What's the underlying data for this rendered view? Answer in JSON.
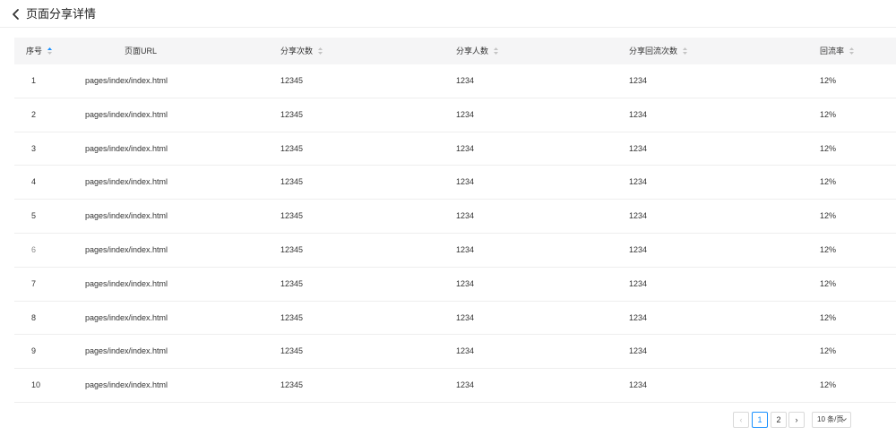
{
  "header": {
    "title": "页面分享详情",
    "back_icon": "chevron-left-icon"
  },
  "table": {
    "columns": [
      {
        "key": "index",
        "label": "序号",
        "sortable": true,
        "sort": "asc"
      },
      {
        "key": "url",
        "label": "页面URL",
        "sortable": false
      },
      {
        "key": "share_count",
        "label": "分享次数",
        "sortable": true
      },
      {
        "key": "share_users",
        "label": "分享人数",
        "sortable": true
      },
      {
        "key": "return_count",
        "label": "分享回流次数",
        "sortable": true
      },
      {
        "key": "return_rate",
        "label": "回流率",
        "sortable": true
      }
    ],
    "rows": [
      {
        "index": "1",
        "url": "pages/index/index.html",
        "share_count": "12345",
        "share_users": "1234",
        "return_count": "1234",
        "return_rate": "12%"
      },
      {
        "index": "2",
        "url": "pages/index/index.html",
        "share_count": "12345",
        "share_users": "1234",
        "return_count": "1234",
        "return_rate": "12%"
      },
      {
        "index": "3",
        "url": "pages/index/index.html",
        "share_count": "12345",
        "share_users": "1234",
        "return_count": "1234",
        "return_rate": "12%"
      },
      {
        "index": "4",
        "url": "pages/index/index.html",
        "share_count": "12345",
        "share_users": "1234",
        "return_count": "1234",
        "return_rate": "12%"
      },
      {
        "index": "5",
        "url": "pages/index/index.html",
        "share_count": "12345",
        "share_users": "1234",
        "return_count": "1234",
        "return_rate": "12%"
      },
      {
        "index": "6",
        "url": "pages/index/index.html",
        "share_count": "12345",
        "share_users": "1234",
        "return_count": "1234",
        "return_rate": "12%"
      },
      {
        "index": "7",
        "url": "pages/index/index.html",
        "share_count": "12345",
        "share_users": "1234",
        "return_count": "1234",
        "return_rate": "12%"
      },
      {
        "index": "8",
        "url": "pages/index/index.html",
        "share_count": "12345",
        "share_users": "1234",
        "return_count": "1234",
        "return_rate": "12%"
      },
      {
        "index": "9",
        "url": "pages/index/index.html",
        "share_count": "12345",
        "share_users": "1234",
        "return_count": "1234",
        "return_rate": "12%"
      },
      {
        "index": "10",
        "url": "pages/index/index.html",
        "share_count": "12345",
        "share_users": "1234",
        "return_count": "1234",
        "return_rate": "12%"
      }
    ]
  },
  "pagination": {
    "prev_label": "‹",
    "next_label": "›",
    "pages": [
      "1",
      "2"
    ],
    "current_page": "1",
    "page_size_label": "10 条/页"
  },
  "colors": {
    "accent": "#1890ff",
    "header_bg": "#f5f5f6",
    "border": "#eeeeee"
  }
}
